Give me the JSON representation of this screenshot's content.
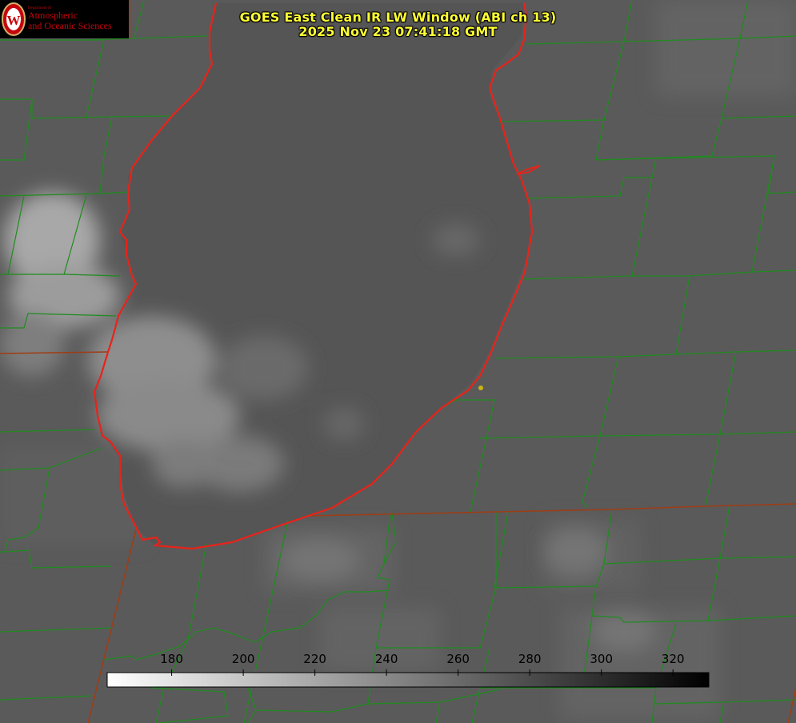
{
  "logo": {
    "department": "Department of",
    "line1": "Atmospheric",
    "line2": "and Oceanic Sciences",
    "seal_letter": "W",
    "color": "#c5050c"
  },
  "title": {
    "line1": "GOES East Clean IR LW Window (ABI ch 13)",
    "line2": "2025 Nov 23 07:41:18 GMT",
    "color": "#ffff33"
  },
  "colorbar": {
    "min": 162,
    "max": 330,
    "ticks": [
      180,
      200,
      220,
      240,
      260,
      280,
      300,
      320
    ],
    "colors": [
      "#ffffff",
      "#000000"
    ]
  },
  "overlay_colors": {
    "county_lines": "#1e8c1e",
    "state_lines": "#a03c14",
    "lake_shoreline": "#e8231a",
    "marker": "#c8b414"
  },
  "icons": [
    "uw-crest-icon",
    "location-marker-icon"
  ]
}
